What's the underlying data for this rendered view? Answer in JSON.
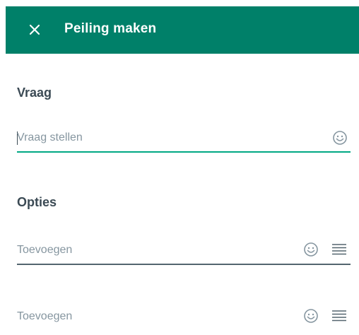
{
  "header": {
    "title": "Peiling maken",
    "close_icon": "close-icon",
    "background_color": "#008069"
  },
  "question": {
    "section_title": "Vraag",
    "input_value": "",
    "input_placeholder": "Vraag stellen",
    "emoji_icon": "emoji-icon",
    "accent_color": "#00a884"
  },
  "options": {
    "section_title": "Opties",
    "items": [
      {
        "input_value": "",
        "input_placeholder": "Toevoegen",
        "emoji_icon": "emoji-icon",
        "drag_icon": "drag-handle-icon"
      },
      {
        "input_value": "",
        "input_placeholder": "Toevoegen",
        "emoji_icon": "emoji-icon",
        "drag_icon": "drag-handle-icon"
      }
    ]
  }
}
